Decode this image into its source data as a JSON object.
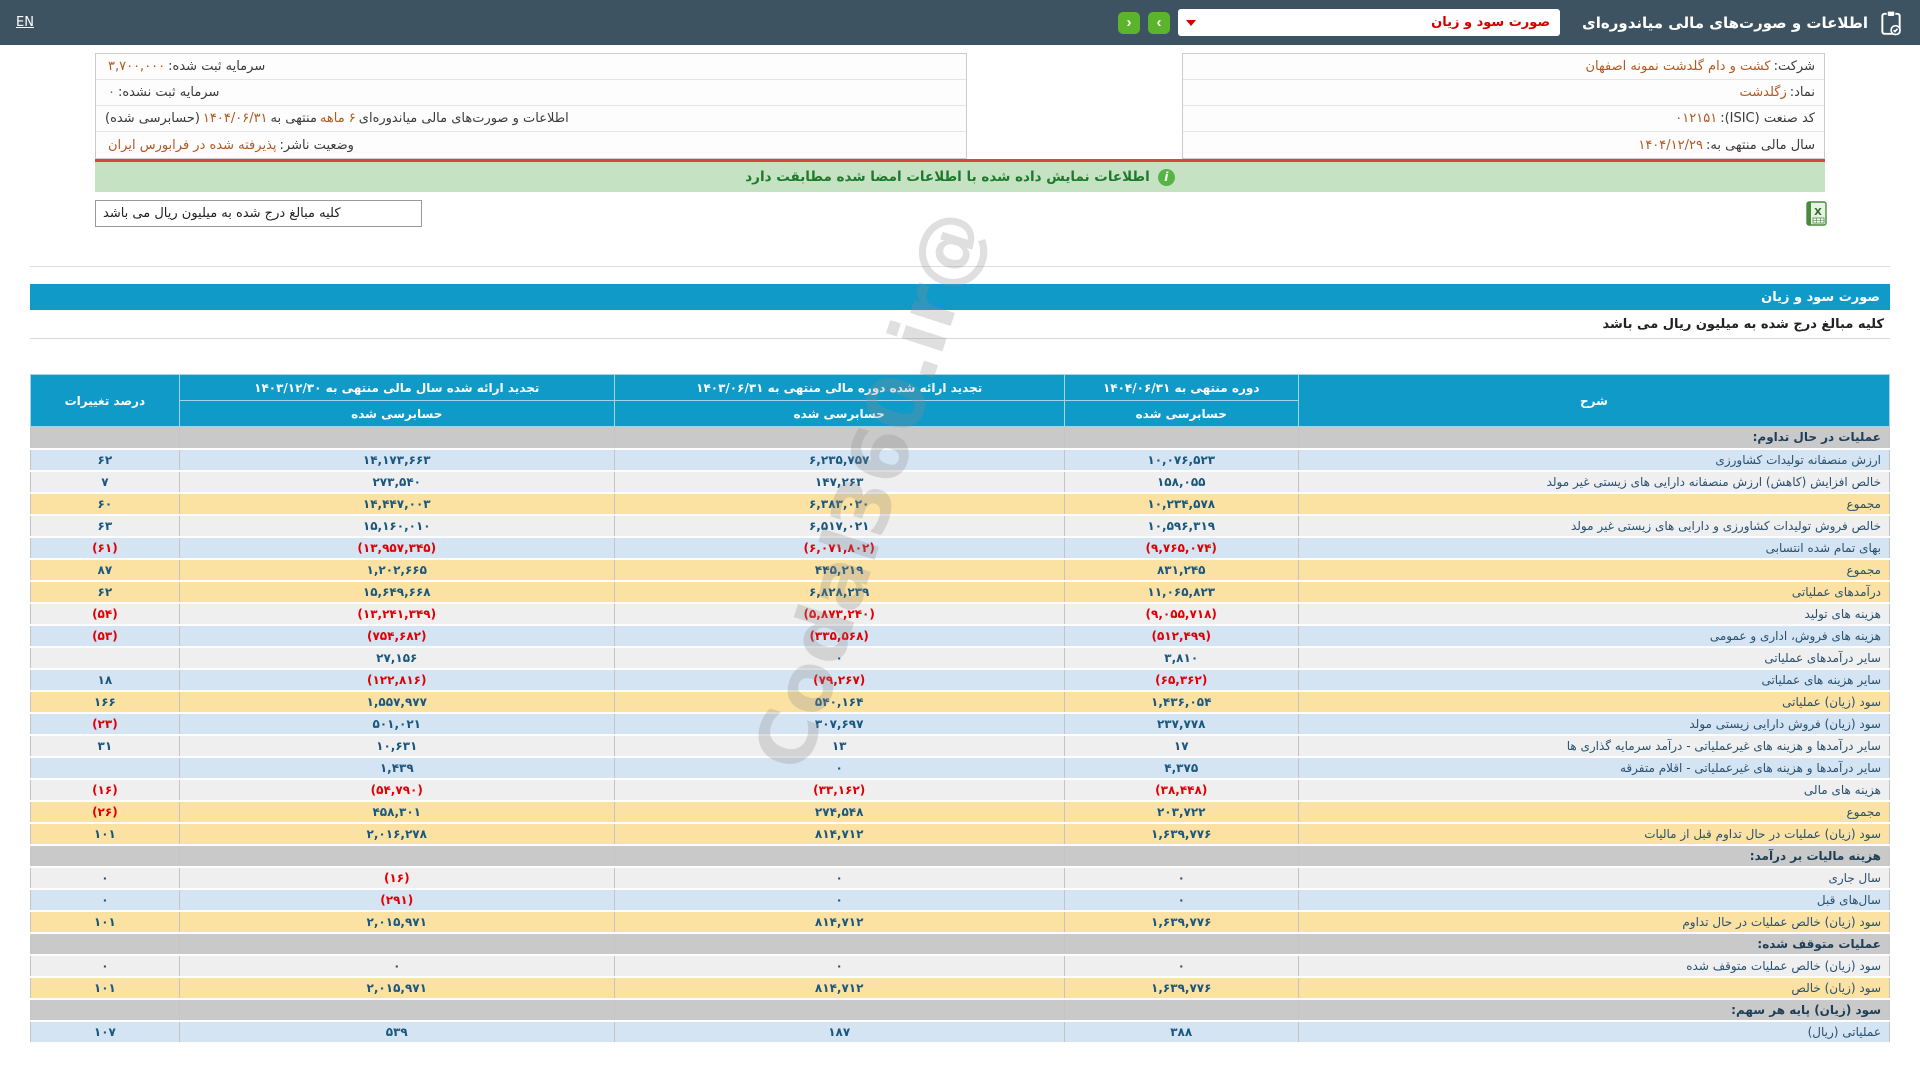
{
  "topbar": {
    "en_label": "EN",
    "title": "اطلاعات و صورت‌های مالی میاندوره‌ای",
    "dropdown_value": "صورت سود و زیان",
    "next_glyph": "›",
    "prev_glyph": "‹"
  },
  "company_info": {
    "right": [
      [
        {
          "t": "شرکت:",
          "c": "label"
        },
        {
          "t": "کشت و دام گلدشت نمونه اصفهان",
          "c": "value"
        }
      ],
      [
        {
          "t": "نماد:",
          "c": "label"
        },
        {
          "t": "زگلدشت",
          "c": "value"
        }
      ],
      [
        {
          "t": "کد صنعت (ISIC):",
          "c": "label"
        },
        {
          "t": "۰۱۲۱۵۱",
          "c": "value"
        }
      ],
      [
        {
          "t": "سال مالی منتهی به:",
          "c": "label"
        },
        {
          "t": "۱۴۰۴/۱۲/۲۹",
          "c": "value"
        }
      ]
    ],
    "left": [
      [
        {
          "t": "سرمایه ثبت شده:",
          "c": "label"
        },
        {
          "t": "۳,۷۰۰,۰۰۰",
          "c": "value"
        }
      ],
      [
        {
          "t": "سرمایه ثبت نشده:",
          "c": "label"
        },
        {
          "t": "۰",
          "c": "value"
        }
      ],
      [
        {
          "t": "اطلاعات و صورت‌های مالی میاندوره‌ای",
          "c": "label"
        },
        {
          "t": "۶ ماهه",
          "c": "value"
        },
        {
          "t": "منتهی به",
          "c": "label"
        },
        {
          "t": "۱۴۰۴/۰۶/۳۱",
          "c": "value"
        },
        {
          "t": "(حسابرسی شده)",
          "c": "label"
        }
      ],
      [
        {
          "t": "وضعیت ناشر:",
          "c": "label"
        },
        {
          "t": "پذیرفته شده در فرابورس ایران",
          "c": "value"
        }
      ]
    ]
  },
  "green_bar_text": "اطلاعات نمایش داده شده با اطلاعات امضا شده مطابقت دارد",
  "units_note": "کلیه مبالغ درج شده به میلیون ریال می باشد",
  "statement_title": "صورت سود و زیان",
  "watermark": "@Codal360.ir",
  "table": {
    "header": {
      "desc": "شرح",
      "current": "دوره منتهی به ۱۴۰۴/۰۶/۳۱",
      "prior": "تجدید ارائه شده دوره مالی منتهی به ۱۴۰۳/۰۶/۳۱",
      "year": "تجدید ارائه شده سال مالی منتهی به ۱۴۰۳/۱۲/۳۰",
      "pct": "درصد تغییرات",
      "audited": "حسابرسی شده"
    },
    "rows": [
      {
        "type": "section",
        "bg": "sec",
        "desc": "عملیات در حال تداوم:",
        "current": "",
        "prior": "",
        "year": "",
        "pct": ""
      },
      {
        "type": "data",
        "bg": "blue",
        "desc": "ارزش منصفانه تولیدات کشاورزی",
        "current": "۱۰,۰۷۶,۵۲۳",
        "prior": "۶,۲۳۵,۷۵۷",
        "year": "۱۴,۱۷۳,۶۶۳",
        "pct": "۶۲"
      },
      {
        "type": "data",
        "bg": "plain",
        "desc": "خالص افزایش (کاهش) ارزش منصفانه دارایی های زیستی غیر مولد",
        "current": "۱۵۸,۰۵۵",
        "prior": "۱۴۷,۲۶۳",
        "year": "۲۷۳,۵۴۰",
        "pct": "۷"
      },
      {
        "type": "data",
        "bg": "yellow",
        "desc": "مجموع",
        "current": "۱۰,۲۳۴,۵۷۸",
        "prior": "۶,۳۸۳,۰۲۰",
        "year": "۱۴,۴۴۷,۰۰۳",
        "pct": "۶۰"
      },
      {
        "type": "data",
        "bg": "plain",
        "desc": "خالص فروش تولیدات کشاورزی و دارایی های زیستی غیر مولد",
        "current": "۱۰,۵۹۶,۳۱۹",
        "prior": "۶,۵۱۷,۰۲۱",
        "year": "۱۵,۱۶۰,۰۱۰",
        "pct": "۶۳"
      },
      {
        "type": "data",
        "bg": "blue",
        "desc": "بهای تمام شده انتسابی",
        "current": "(۹,۷۶۵,۰۷۴)",
        "prior": "(۶,۰۷۱,۸۰۲)",
        "year": "(۱۳,۹۵۷,۳۴۵)",
        "pct": "(۶۱)"
      },
      {
        "type": "data",
        "bg": "yellow",
        "desc": "مجموع",
        "current": "۸۳۱,۲۴۵",
        "prior": "۴۴۵,۲۱۹",
        "year": "۱,۲۰۲,۶۶۵",
        "pct": "۸۷"
      },
      {
        "type": "data",
        "bg": "yellow",
        "desc": "درآمدهای عملیاتی",
        "current": "۱۱,۰۶۵,۸۲۳",
        "prior": "۶,۸۲۸,۲۳۹",
        "year": "۱۵,۶۴۹,۶۶۸",
        "pct": "۶۲"
      },
      {
        "type": "data",
        "bg": "plain",
        "desc": "هزینه های تولید",
        "current": "(۹,۰۵۵,۷۱۸)",
        "prior": "(۵,۸۷۳,۲۴۰)",
        "year": "(۱۳,۲۴۱,۳۴۹)",
        "pct": "(۵۴)"
      },
      {
        "type": "data",
        "bg": "blue",
        "desc": "هزینه های فروش، اداری و عمومی",
        "current": "(۵۱۲,۴۹۹)",
        "prior": "(۳۳۵,۵۶۸)",
        "year": "(۷۵۴,۶۸۲)",
        "pct": "(۵۳)"
      },
      {
        "type": "data",
        "bg": "plain",
        "desc": "سایر درآمدهای عملیاتی",
        "current": "۳,۸۱۰",
        "prior": "۰",
        "year": "۲۷,۱۵۶",
        "pct": ""
      },
      {
        "type": "data",
        "bg": "blue",
        "desc": "سایر هزینه های عملیاتی",
        "current": "(۶۵,۳۶۲)",
        "prior": "(۷۹,۲۶۷)",
        "year": "(۱۲۲,۸۱۶)",
        "pct": "۱۸"
      },
      {
        "type": "data",
        "bg": "yellow",
        "desc": "سود (زیان) عملیاتی",
        "current": "۱,۴۳۶,۰۵۴",
        "prior": "۵۴۰,۱۶۴",
        "year": "۱,۵۵۷,۹۷۷",
        "pct": "۱۶۶"
      },
      {
        "type": "data",
        "bg": "blue",
        "desc": "سود (زیان) فروش دارایی زیستی مولد",
        "current": "۲۳۷,۷۷۸",
        "prior": "۳۰۷,۶۹۷",
        "year": "۵۰۱,۰۲۱",
        "pct": "(۲۳)"
      },
      {
        "type": "data",
        "bg": "plain",
        "desc": "سایر درآمدها و هزینه های غیرعملیاتی - درآمد سرمایه گذاری ها",
        "current": "۱۷",
        "prior": "۱۳",
        "year": "۱۰,۶۳۱",
        "pct": "۳۱"
      },
      {
        "type": "data",
        "bg": "blue",
        "desc": "سایر درآمدها و هزینه های غیرعملیاتی - اقلام متفرقه",
        "current": "۴,۳۷۵",
        "prior": "۰",
        "year": "۱,۴۳۹",
        "pct": ""
      },
      {
        "type": "data",
        "bg": "plain",
        "desc": "هزینه های مالی",
        "current": "(۳۸,۴۴۸)",
        "prior": "(۳۳,۱۶۲)",
        "year": "(۵۴,۷۹۰)",
        "pct": "(۱۶)"
      },
      {
        "type": "data",
        "bg": "yellow",
        "desc": "مجموع",
        "current": "۲۰۳,۷۲۲",
        "prior": "۲۷۴,۵۴۸",
        "year": "۴۵۸,۳۰۱",
        "pct": "(۲۶)"
      },
      {
        "type": "data",
        "bg": "yellow",
        "desc": "سود (زیان) عملیات در حال تداوم قبل از مالیات",
        "current": "۱,۶۳۹,۷۷۶",
        "prior": "۸۱۴,۷۱۲",
        "year": "۲,۰۱۶,۲۷۸",
        "pct": "۱۰۱"
      },
      {
        "type": "section",
        "bg": "sec",
        "desc": "هزینه مالیات بر درآمد:",
        "current": "",
        "prior": "",
        "year": "",
        "pct": ""
      },
      {
        "type": "data",
        "bg": "plain",
        "desc": "سال جاری",
        "current": "۰",
        "prior": "۰",
        "year": "(۱۶)",
        "pct": "۰"
      },
      {
        "type": "data",
        "bg": "blue",
        "desc": "سال‌های قبل",
        "current": "۰",
        "prior": "۰",
        "year": "(۲۹۱)",
        "pct": "۰"
      },
      {
        "type": "data",
        "bg": "yellow",
        "desc": "سود (زیان) خالص عملیات در حال تداوم",
        "current": "۱,۶۳۹,۷۷۶",
        "prior": "۸۱۴,۷۱۲",
        "year": "۲,۰۱۵,۹۷۱",
        "pct": "۱۰۱"
      },
      {
        "type": "section",
        "bg": "sec",
        "desc": "عملیات متوقف شده:",
        "current": "",
        "prior": "",
        "year": "",
        "pct": ""
      },
      {
        "type": "data",
        "bg": "plain",
        "desc": "سود (زیان) خالص عملیات متوقف شده",
        "current": "۰",
        "prior": "۰",
        "year": "۰",
        "pct": "۰"
      },
      {
        "type": "data",
        "bg": "yellow",
        "desc": "سود (زیان) خالص",
        "current": "۱,۶۳۹,۷۷۶",
        "prior": "۸۱۴,۷۱۲",
        "year": "۲,۰۱۵,۹۷۱",
        "pct": "۱۰۱"
      },
      {
        "type": "section",
        "bg": "sec",
        "desc": "سود (زیان) پایه هر سهم:",
        "current": "",
        "prior": "",
        "year": "",
        "pct": ""
      },
      {
        "type": "data",
        "bg": "blue",
        "desc": "عملیاتی (ریال)",
        "current": "۳۸۸",
        "prior": "۱۸۷",
        "year": "۵۳۹",
        "pct": "۱۰۷"
      }
    ]
  }
}
